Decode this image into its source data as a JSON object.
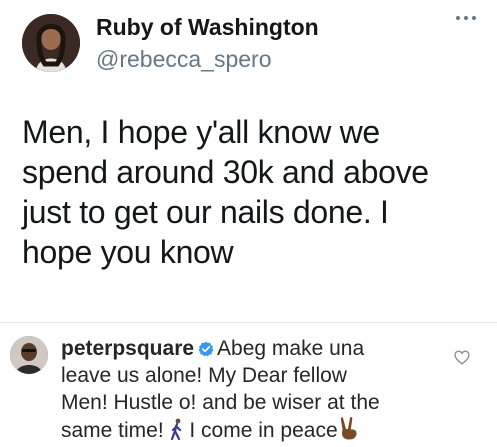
{
  "tweet": {
    "author_name": "Ruby of Washington",
    "author_handle": "@rebecca_spero",
    "text_lines": [
      "Men, I hope y'all know we",
      "spend around 30k and above",
      "just to get our nails done. I",
      "hope you know"
    ]
  },
  "comment": {
    "username": "peterpsquare",
    "lines": [
      "Abeg make una",
      "leave us alone! My Dear fellow",
      "Men! Hustle o! and be wiser at the",
      "same time!",
      "I come in peace"
    ]
  },
  "icons": {
    "more": "more-horizontal-icon",
    "verified": "verified-badge-icon",
    "like": "heart-outline-icon",
    "walking": "person-walking-emoji",
    "peace": "victory-hand-emoji"
  },
  "colors": {
    "text": "#14171a",
    "handle": "#657786",
    "verified": "#3897f0",
    "comment_text": "#262626"
  }
}
